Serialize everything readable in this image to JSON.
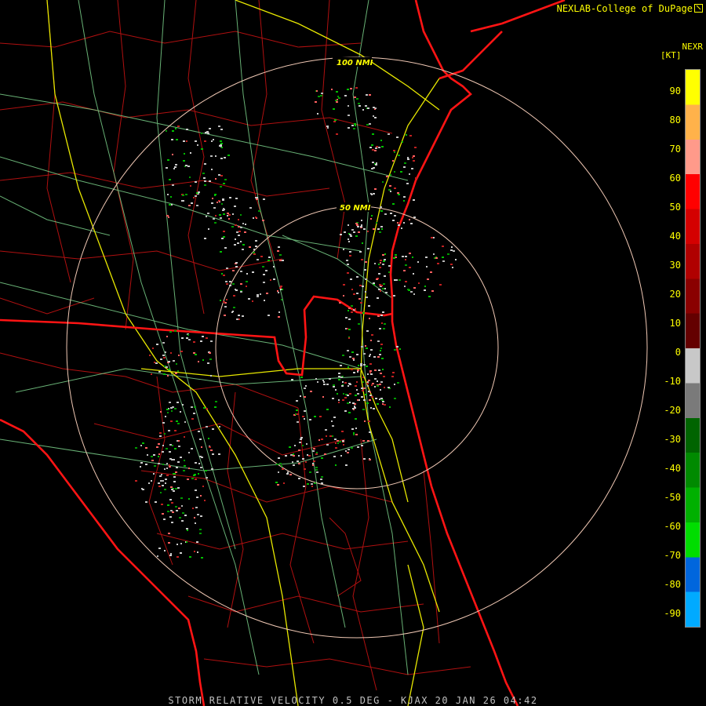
{
  "credit": "NEXLAB-College of DuPage",
  "product": "NEXR",
  "unit": "[KT]",
  "scale_ticks": [
    "90",
    "80",
    "70",
    "60",
    "50",
    "40",
    "30",
    "20",
    "10",
    "0",
    "-10",
    "-20",
    "-30",
    "-40",
    "-50",
    "-60",
    "-70",
    "-80",
    "-90"
  ],
  "scale_colors": [
    "#ffff00",
    "#ffb24a",
    "#ff9a8a",
    "#ff0000",
    "#d40000",
    "#b00000",
    "#8a0000",
    "#640000",
    "#c8c8c8",
    "#7a7a7a",
    "#006400",
    "#008a00",
    "#00b000",
    "#00dd00",
    "#0066dd",
    "#00aaff"
  ],
  "ring_labels": [
    "100 NMI",
    "50 NMI"
  ],
  "footer": "STORM RELATIVE VELOCITY 0.5 DEG - KJAX 20 JAN 26 04:42"
}
